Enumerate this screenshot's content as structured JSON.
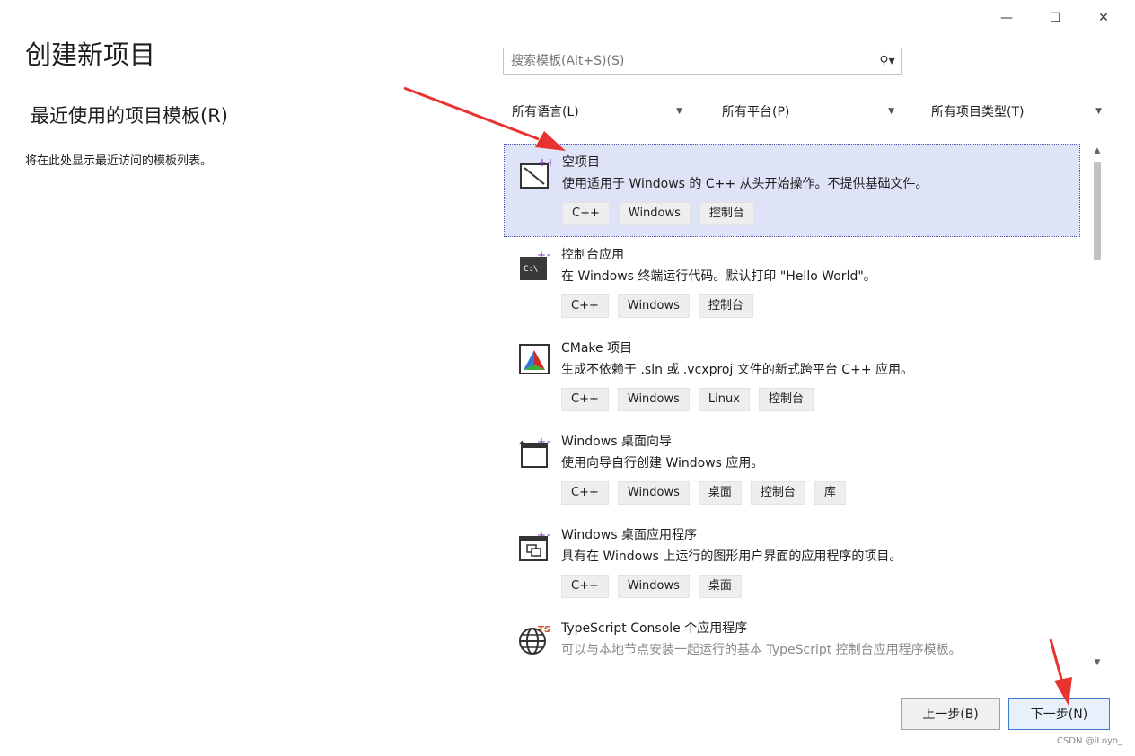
{
  "window": {
    "minimize_icon": "minimize-icon",
    "maximize_icon": "maximize-icon",
    "close_icon": "close-icon"
  },
  "page_title": "创建新项目",
  "recent": {
    "title": "最近使用的项目模板(R)",
    "description": "将在此处显示最近访问的模板列表。"
  },
  "search": {
    "placeholder": "搜索模板(Alt+S)(S)",
    "icon": "search-icon"
  },
  "filters": {
    "language": "所有语言(L)",
    "platform": "所有平台(P)",
    "project_type": "所有项目类型(T)"
  },
  "templates": [
    {
      "name": "空项目",
      "description": "使用适用于 Windows 的 C++ 从头开始操作。不提供基础文件。",
      "tags": [
        "C++",
        "Windows",
        "控制台"
      ],
      "icon": "empty-project-icon",
      "selected": true
    },
    {
      "name": "控制台应用",
      "description": "在 Windows 终端运行代码。默认打印 \"Hello World\"。",
      "tags": [
        "C++",
        "Windows",
        "控制台"
      ],
      "icon": "console-app-icon"
    },
    {
      "name": "CMake 项目",
      "description": "生成不依赖于 .sln 或 .vcxproj 文件的新式跨平台 C++ 应用。",
      "tags": [
        "C++",
        "Windows",
        "Linux",
        "控制台"
      ],
      "icon": "cmake-icon"
    },
    {
      "name": "Windows 桌面向导",
      "description": "使用向导自行创建 Windows 应用。",
      "tags": [
        "C++",
        "Windows",
        "桌面",
        "控制台",
        "库"
      ],
      "icon": "desktop-wizard-icon"
    },
    {
      "name": "Windows 桌面应用程序",
      "description": "具有在 Windows 上运行的图形用户界面的应用程序的项目。",
      "tags": [
        "C++",
        "Windows",
        "桌面"
      ],
      "icon": "desktop-app-icon"
    },
    {
      "name": "TypeScript Console 个应用程序",
      "description": "可以与本地节点安装一起运行的基本 TypeScript 控制台应用程序模板。",
      "tags": [],
      "icon": "typescript-globe-icon"
    }
  ],
  "buttons": {
    "back": "上一步(B)",
    "next": "下一步(N)"
  },
  "watermark": "CSDN @iLoyo_",
  "colors": {
    "selected_bg": "#dfe3f7",
    "annotation_arrow": "#e8322f"
  }
}
